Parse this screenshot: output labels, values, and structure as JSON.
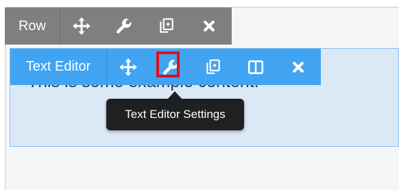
{
  "row_toolbar": {
    "label": "Row",
    "buttons": [
      {
        "icon": "move-icon"
      },
      {
        "icon": "wrench-icon"
      },
      {
        "icon": "duplicate-icon"
      },
      {
        "icon": "close-icon"
      }
    ]
  },
  "module": {
    "toolbar_label": "Text Editor",
    "content_text": "This is some example content.",
    "buttons": [
      {
        "icon": "move-icon"
      },
      {
        "icon": "wrench-icon",
        "highlighted": true
      },
      {
        "icon": "duplicate-icon"
      },
      {
        "icon": "columns-icon"
      },
      {
        "icon": "close-icon"
      }
    ]
  },
  "tooltip": {
    "text": "Text Editor Settings"
  },
  "colors": {
    "row_bar": "#7f7f7f",
    "module_bar": "#41a4f2",
    "module_bg": "#dbe8f5",
    "highlight": "#e20d17",
    "tooltip_bg": "#1f2021"
  }
}
